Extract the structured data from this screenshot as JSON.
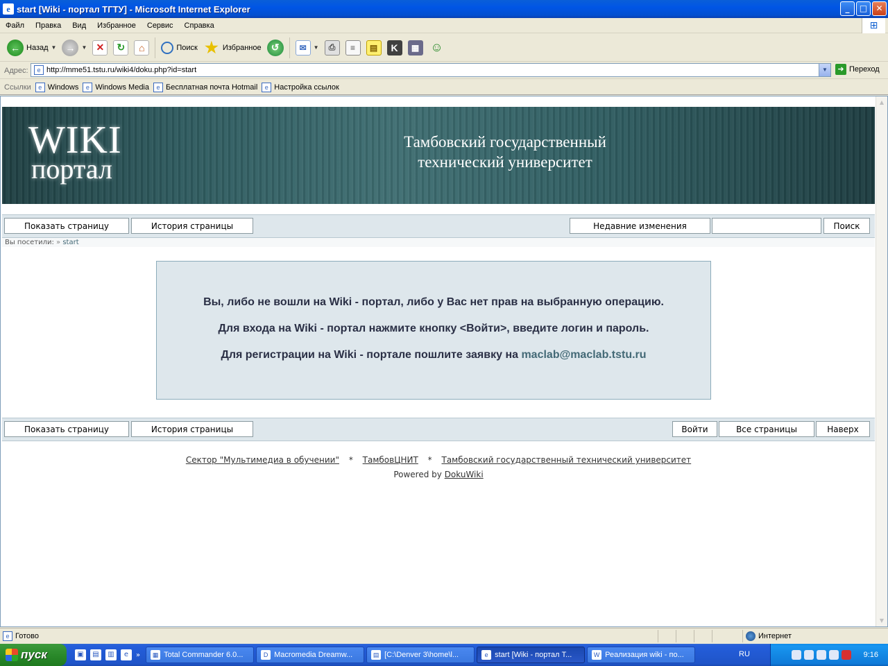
{
  "window": {
    "title": "start [Wiki - портал ТГТУ] - Microsoft Internet Explorer",
    "buttons": [
      "_",
      "□",
      "✕"
    ]
  },
  "menu": [
    "Файл",
    "Правка",
    "Вид",
    "Избранное",
    "Сервис",
    "Справка"
  ],
  "toolbar": {
    "back_label": "Назад",
    "search_label": "Поиск",
    "favorites_label": "Избранное"
  },
  "address": {
    "label": "Адрес:",
    "url": "http://mme51.tstu.ru/wiki4/doku.php?id=start",
    "go_label": "Переход"
  },
  "links": {
    "label": "Ссылки",
    "items": [
      "Windows",
      "Windows Media",
      "Бесплатная почта Hotmail",
      "Настройка ссылок"
    ]
  },
  "banner": {
    "logo_line1": "WIKI",
    "logo_line2": "портал",
    "university_line1": "Тамбовский государственный",
    "university_line2": "технический университет"
  },
  "nav_top": {
    "show_page": "Показать страницу",
    "page_history": "История страницы",
    "recent_changes": "Недавние изменения",
    "search_value": "",
    "search_button": "Поиск"
  },
  "breadcrumb": {
    "label": "Вы посетили:",
    "separator": "»",
    "item": "start"
  },
  "message": {
    "line1": "Вы, либо не вошли на Wiki - портал, либо у Вас нет прав на выбранную операцию.",
    "line2": "Для входа на Wiki - портал нажмите кнопку <Войти>, введите логин и пароль.",
    "line3_text": "Для регистрации на Wiki - портале пошлите заявку на ",
    "line3_email": "maclab@maclab.tstu.ru"
  },
  "nav_bottom": {
    "show_page": "Показать страницу",
    "page_history": "История страницы",
    "login": "Войти",
    "all_pages": "Все страницы",
    "to_top": "Наверх"
  },
  "footer": {
    "link1": "Сектор \"Мультимедиа в обучении\"",
    "link2": "ТамбовЦНИТ",
    "link3": "Тамбовский государственный технический университет",
    "separator": "*",
    "powered_text": "Powered by ",
    "powered_link": "DokuWiki"
  },
  "statusbar": {
    "status": "Готово",
    "zone": "Интернет"
  },
  "taskbar": {
    "start_label": "пуск",
    "tasks": [
      "Total Commander 6.0...",
      "Macromedia Dreamw...",
      "[C:\\Denver 3\\home\\l...",
      "start [Wiki - портал Т...",
      "Реализация wiki - по..."
    ],
    "active_index": 3,
    "language": "RU",
    "clock": "9:16"
  },
  "colors": {
    "xp_blue": "#0055e5",
    "banner_teal": "#2e5a5e",
    "nav_background": "#dee7ec",
    "message_border": "#8cacbb",
    "message_text": "#2a2f45",
    "link_color": "#436976"
  }
}
